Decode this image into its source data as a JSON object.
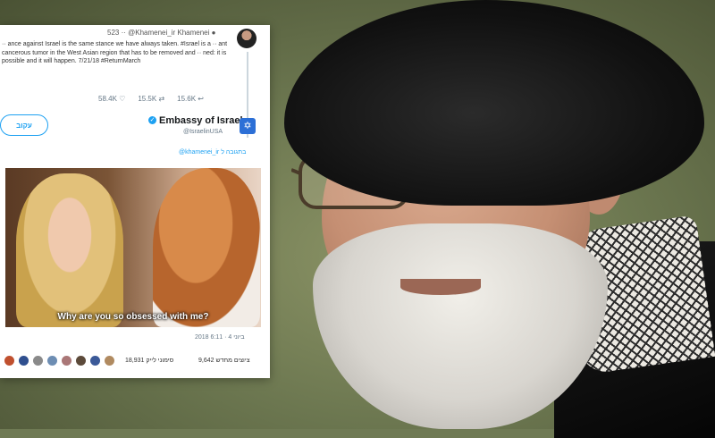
{
  "tweet": {
    "meta": "523 ·· @Khamenei_ir  Khamenei ●",
    "reply_text": "·· ance against Israel is the same stance we have always taken. #Israel is a ·· ant cancerous tumor in the West Asian region that has to be removed and ·· ned: it is possible and it will happen. 7/21/18 #ReturnMarch",
    "actions": [
      "58.4K ♡",
      "15.5K ⇄",
      "15.6K ↩"
    ],
    "follow_label": "עקוב",
    "account_name": "Embassy of Israel",
    "account_handle": "@IsraelinUSA",
    "in_reply_to": "@khamenei_ir בתגובה ל",
    "meme_caption": "Why are you so obsessed with me?",
    "timestamp": "2018 ביוני 4 · 6:11",
    "stats": [
      "9,642 ציוצים מחדש",
      "18,931 סימוני לייק"
    ]
  },
  "colors": {
    "twitter_blue": "#1da1f2",
    "background_green": "#6f7a54"
  }
}
